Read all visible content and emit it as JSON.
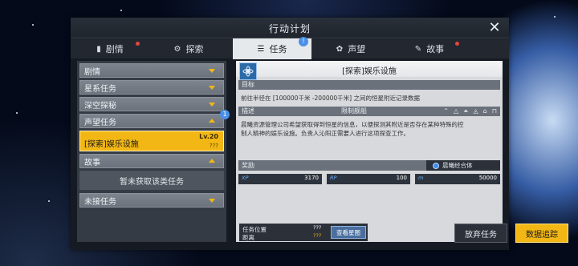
{
  "window": {
    "title": "行动计划"
  },
  "tabs": [
    {
      "label": "剧情",
      "icon": "book-icon",
      "dot": true
    },
    {
      "label": "探索",
      "icon": "compass-icon",
      "dot": false
    },
    {
      "label": "任务",
      "icon": "clipboard-icon",
      "badge": "!"
    },
    {
      "label": "声望",
      "icon": "medal-icon",
      "dot": false
    },
    {
      "label": "故事",
      "icon": "story-icon",
      "dot": true
    }
  ],
  "categories": [
    {
      "label": "剧情",
      "state": "collapsed"
    },
    {
      "label": "星系任务",
      "state": "collapsed"
    },
    {
      "label": "深空探秘",
      "state": "collapsed"
    },
    {
      "label": "声望任务",
      "state": "expanded",
      "badge": "1"
    },
    {
      "label": "故事",
      "state": "expanded"
    },
    {
      "label": "未接任务",
      "state": "collapsed"
    }
  ],
  "selected_task": {
    "name": "[探索]娱乐设施",
    "level": "Lv.20",
    "extra": "???"
  },
  "story_empty": "暂未获取该类任务",
  "detail": {
    "title": "[探索]娱乐设施",
    "goal_label": "目标",
    "goal_text": "前往半径在 [100000千米 -200000千米] 之间的恒星附近记录数据",
    "desc_label": "描述",
    "ship_limit_label": "限制舰船",
    "desc_text_1": "晨曦资源管理公司希望获取得到恒星的信息，以便探测其附近是否存在某种特殊的控",
    "desc_text_2": "制人精神的娱乐设施。负责人沁阳正需要人进行这项探查工作。",
    "reward_label": "奖励",
    "corp_name": "晨曦经合体",
    "rewards": [
      {
        "key": "XP",
        "value": "3170"
      },
      {
        "key": "RP",
        "value": "100"
      },
      {
        "key": "m",
        "value": "50000"
      }
    ]
  },
  "location": {
    "label": "任务位置",
    "distance_label": "距离",
    "value1": "???",
    "value2": "???"
  },
  "buttons": {
    "star_map": "查看星图",
    "abandon": "放弃任务",
    "track": "数据追踪"
  },
  "colors": {
    "accent": "#f2b714",
    "badge": "#4a90e8",
    "dot": "#e2483a"
  }
}
